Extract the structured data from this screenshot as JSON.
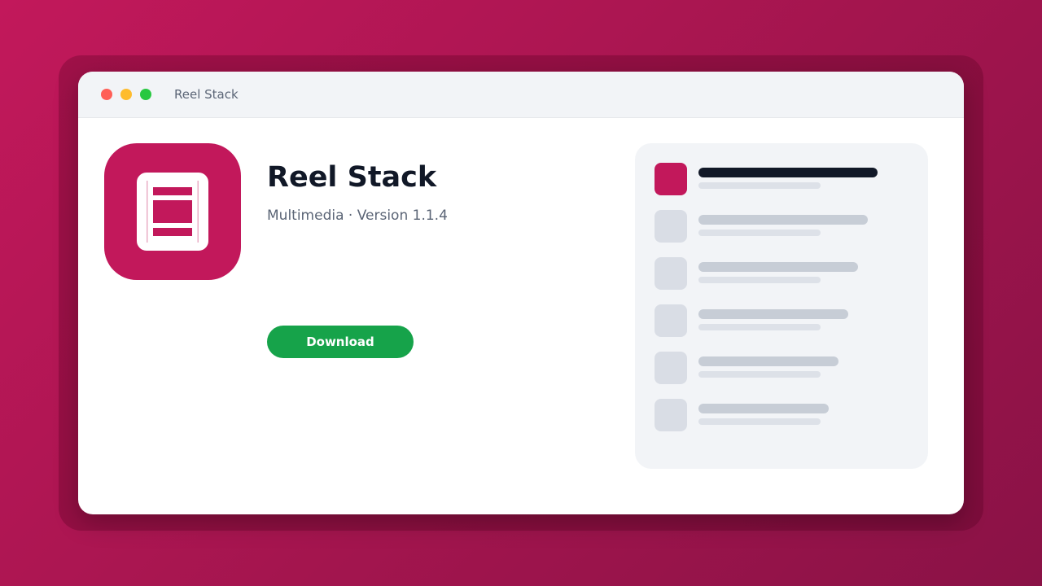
{
  "window": {
    "title": "Reel Stack"
  },
  "app": {
    "name": "Reel Stack",
    "meta": "Multimedia · Version 1.1.4",
    "icon": "film-strip-icon",
    "download_label": "Download"
  },
  "colors": {
    "brand": "#c2185b",
    "download": "#16a34a",
    "dot_close": "#ff5f57",
    "dot_minimize": "#febc2e",
    "dot_maximize": "#28c840",
    "active_line": "#111827"
  },
  "side_panel": {
    "rows": [
      {
        "selected": true
      },
      {
        "selected": false
      },
      {
        "selected": false
      },
      {
        "selected": false
      },
      {
        "selected": false
      },
      {
        "selected": false
      }
    ]
  }
}
